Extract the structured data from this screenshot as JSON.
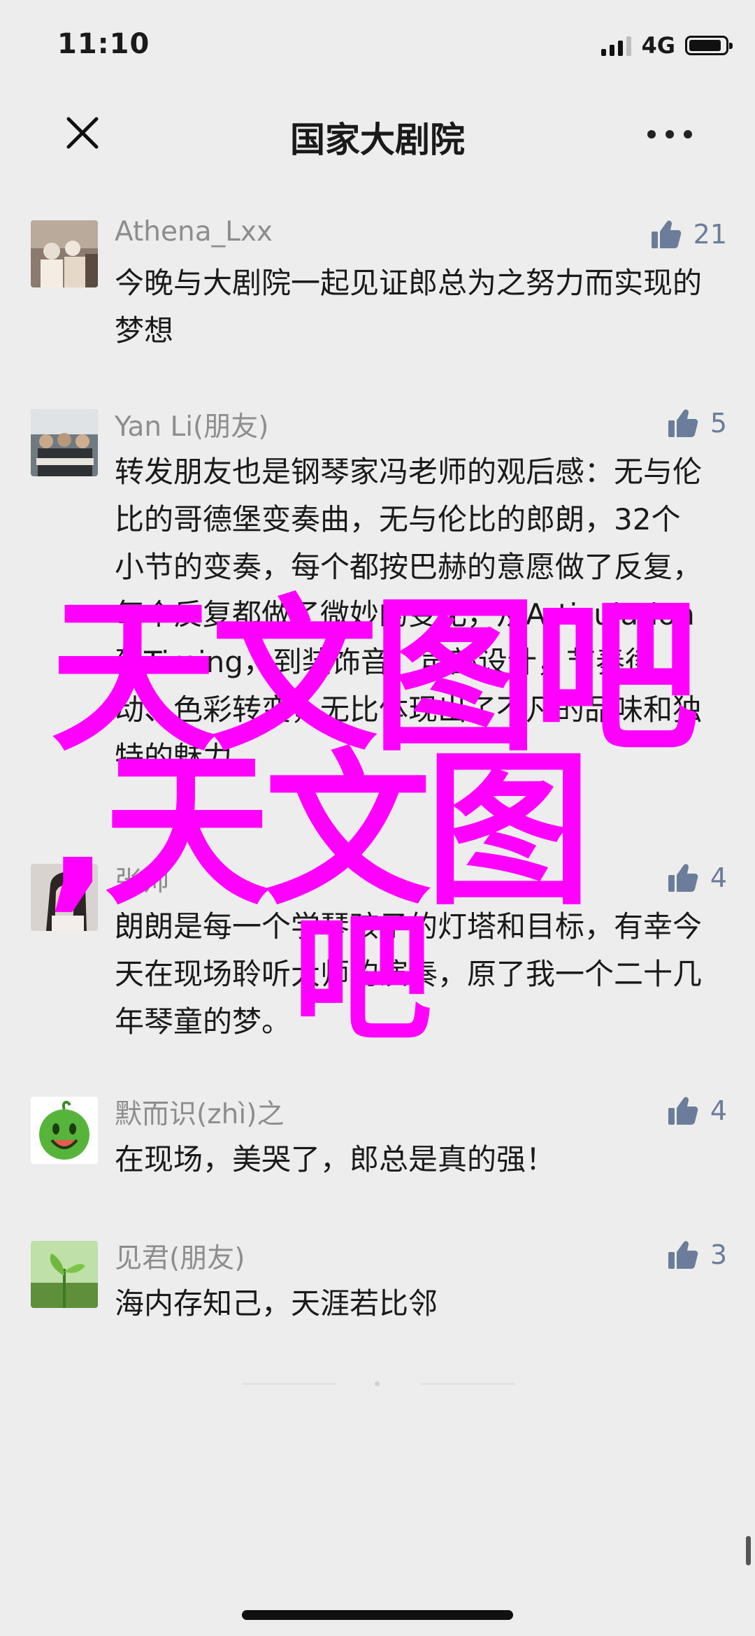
{
  "status_bar": {
    "time": "11:10",
    "network": "4G",
    "battery_level": 0.9
  },
  "nav": {
    "close_icon": "close-icon",
    "title": "国家大剧院",
    "more_icon": "more-icon"
  },
  "comments": [
    {
      "author": "Athena_Lxx",
      "likes": "21",
      "text": "今晚与大剧院一起见证郎总为之努力而实现的梦想"
    },
    {
      "author": "Yan Li(朋友)",
      "likes": "5",
      "text": "转发朋友也是钢琴家冯老师的观后感：无与伦比的哥德堡变奏曲，无与伦比的郎朗，32个小节的变奏，每个都按巴赫的意愿做了反复，每个反复都做了微妙的变化，从Articulation到Timing，到装饰音、声部设计，节奏律动、色彩转变，无比体现出了不凡的品味和独特的魅力"
    },
    {
      "author": "张帅",
      "likes": "4",
      "text": "朗朗是每一个学琴孩子的灯塔和目标，有幸今天在现场聆听大师的演奏，原了我一个二十几年琴童的梦。"
    },
    {
      "author": "默而识(zhì)之",
      "likes": "4",
      "text": "在现场，美哭了，郎总是真的强！"
    },
    {
      "author": "见君(朋友)",
      "likes": "3",
      "text": "海内存知己，天涯若比邻"
    }
  ],
  "watermark": {
    "line1": "天文图吧",
    "line2": ",天文图",
    "line3": "吧"
  },
  "colors": {
    "background": "#ededed",
    "author": "#8d8d8d",
    "like": "#6b7d9a",
    "watermark": "#ff00ff"
  }
}
